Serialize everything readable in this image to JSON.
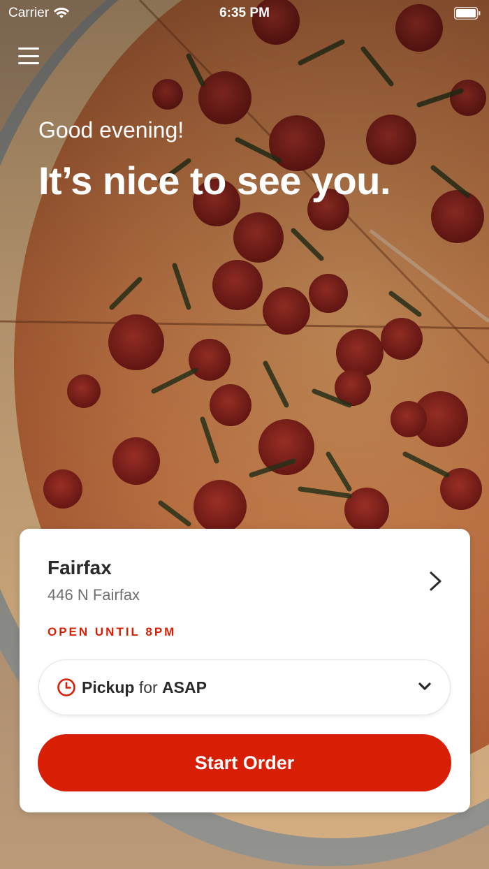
{
  "status_bar": {
    "carrier": "Carrier",
    "time": "6:35 PM"
  },
  "menu": {
    "icon": "hamburger-menu-icon"
  },
  "hero": {
    "greeting": "Good evening!",
    "headline": "It’s nice to see you."
  },
  "store_card": {
    "name": "Fairfax",
    "address": "446 N Fairfax",
    "open_status": "OPEN UNTIL 8PM",
    "chevron_icon": "chevron-right-icon"
  },
  "order_mode": {
    "icon": "clock-icon",
    "mode": "Pickup",
    "connector": "for",
    "time": "ASAP",
    "dropdown_icon": "chevron-down-icon"
  },
  "actions": {
    "start_order": "Start Order"
  },
  "colors": {
    "brand_red": "#d81e05",
    "card_background": "#ffffff",
    "text_dark": "#2a2a2a",
    "text_muted": "#6f6f6f"
  }
}
